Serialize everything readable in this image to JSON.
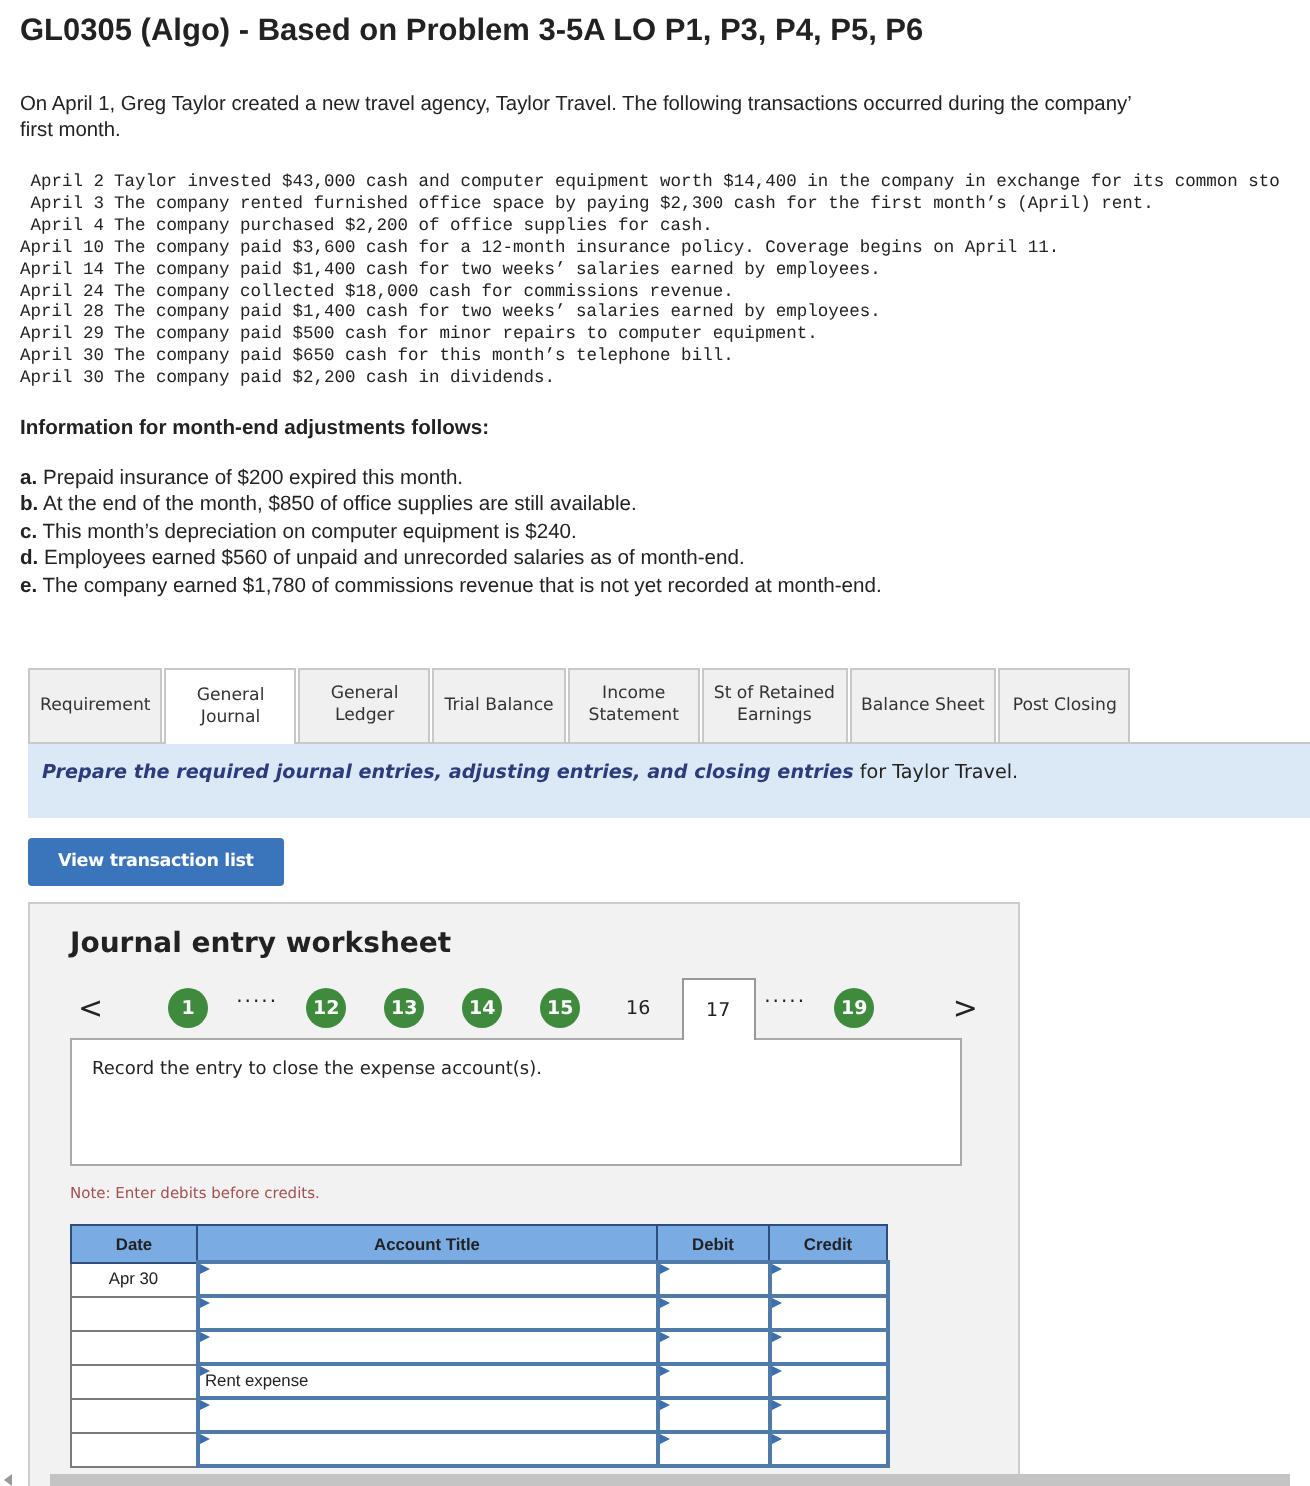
{
  "title": "GL0305 (Algo) - Based on Problem 3-5A LO P1, P3, P4, P5, P6",
  "intro": [
    "On April 1, Greg Taylor created a new travel agency, Taylor Travel. The following transactions occurred during the company’",
    "first month."
  ],
  "transactions": [
    {
      "date": "April 2",
      "text": "Taylor invested $43,000 cash and computer equipment worth $14,400 in the company in exchange for its common sto"
    },
    {
      "date": "April 3",
      "text": "The company rented furnished office space by paying $2,300 cash for the first month’s (April) rent."
    },
    {
      "date": "April 4",
      "text": "The company purchased $2,200 of office supplies for cash."
    },
    {
      "date": "April 10",
      "text": "The company paid $3,600 cash for a 12-month insurance policy. Coverage begins on April 11."
    },
    {
      "date": "April 14",
      "text": "The company paid $1,400 cash for two weeks’ salaries earned by employees."
    },
    {
      "date": "April 24",
      "text": "The company collected $18,000 cash for commissions revenue."
    },
    {
      "date": "April 28",
      "text": "The company paid $1,400 cash for two weeks’ salaries earned by employees."
    },
    {
      "date": "April 29",
      "text": "The company paid $500 cash for minor repairs to computer equipment."
    },
    {
      "date": "April 30",
      "text": "The company paid $650 cash for this month’s telephone bill."
    },
    {
      "date": "April 30",
      "text": "The company paid $2,200 cash in dividends."
    }
  ],
  "adjustments_heading": "Information for month-end adjustments follows:",
  "adjustments": [
    "**a.** Prepaid insurance of $200 expired this month.",
    "**b.** At the end of the month, $850 of office supplies are still available.",
    "**c.** This month’s depreciation on computer equipment is $240.",
    "**d.** Employees earned $560 of unpaid and unrecorded salaries as of month-end.",
    "**e.** The company earned $1,780 of commissions revenue that is not yet recorded at month-end."
  ],
  "tabs": [
    {
      "label": "Requirement",
      "selected": false
    },
    {
      "label": "General\nJournal",
      "selected": true
    },
    {
      "label": "General\nLedger",
      "selected": false
    },
    {
      "label": "Trial Balance",
      "selected": false
    },
    {
      "label": "Income\nStatement",
      "selected": false
    },
    {
      "label": "St of Retained\nEarnings",
      "selected": false
    },
    {
      "label": "Balance Sheet",
      "selected": false
    },
    {
      "label": "Post Closing",
      "selected": false
    }
  ],
  "instruction": "**Prepare the required journal entries, adjusting entries, and closing entries** for Taylor Travel.",
  "view_button": "View transaction list",
  "worksheet": {
    "title": "Journal entry worksheet",
    "prev": "<",
    "next": ">",
    "steps": [
      {
        "kind": "step",
        "label": "1",
        "done": true,
        "selected": false
      },
      {
        "kind": "ellipsis",
        "label": "....."
      },
      {
        "kind": "step",
        "label": "12",
        "done": true,
        "selected": false
      },
      {
        "kind": "step",
        "label": "13",
        "done": true,
        "selected": false
      },
      {
        "kind": "step",
        "label": "14",
        "done": true,
        "selected": false
      },
      {
        "kind": "step",
        "label": "15",
        "done": true,
        "selected": false
      },
      {
        "kind": "step",
        "label": "16",
        "done": false,
        "selected": false
      },
      {
        "kind": "step",
        "label": "17",
        "done": false,
        "selected": true
      },
      {
        "kind": "ellipsis",
        "label": "....."
      },
      {
        "kind": "step",
        "label": "19",
        "done": true,
        "selected": false
      }
    ],
    "prompt": "Record the entry to close the expense account(s).",
    "note": "Note: Enter debits before credits.",
    "columns": [
      "Date",
      "Account Title",
      "Debit",
      "Credit"
    ],
    "rows": [
      {
        "date": "Apr 30",
        "account": "",
        "debit": "",
        "credit": ""
      },
      {
        "date": "",
        "account": "",
        "debit": "",
        "credit": ""
      },
      {
        "date": "",
        "account": "",
        "debit": "",
        "credit": ""
      },
      {
        "date": "",
        "account": "Rent expense",
        "debit": "",
        "credit": ""
      },
      {
        "date": "",
        "account": "",
        "debit": "",
        "credit": ""
      },
      {
        "date": "",
        "account": "",
        "debit": "",
        "credit": ""
      }
    ]
  }
}
